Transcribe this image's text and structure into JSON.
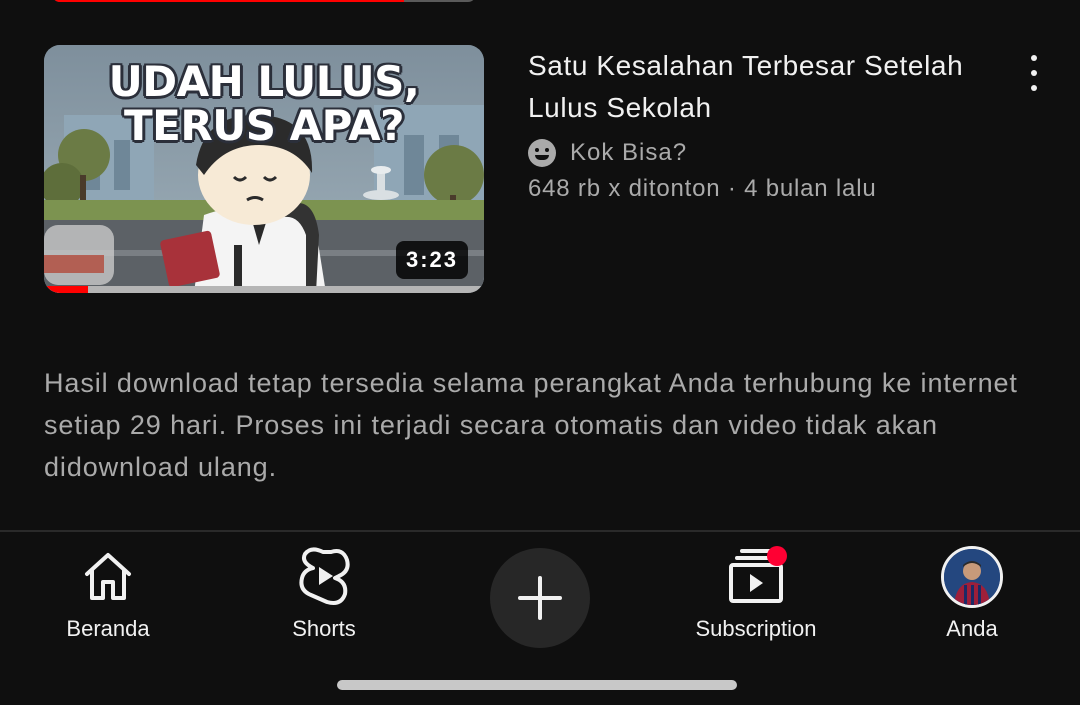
{
  "previous_item": {
    "watch_progress": 0.83
  },
  "video": {
    "thumbnail_text_line1": "UDAH LULUS,",
    "thumbnail_text_line2": "TERUS APA?",
    "duration": "3:23",
    "watch_progress": 0.1,
    "title": "Satu Kesalahan Terbesar Setelah Lulus Sekolah",
    "channel": "Kok Bisa?",
    "stats": "648 rb x ditonton · 4 bulan lalu",
    "more_icon": "more-vertical-icon"
  },
  "info_text": "Hasil download tetap tersedia selama perangkat Anda terhubung ke internet setiap 29 hari. Proses ini terjadi secara otomatis dan video tidak akan didownload ulang.",
  "bottom_nav": {
    "home_label": "Beranda",
    "shorts_label": "Shorts",
    "create_icon": "plus-icon",
    "subscriptions_label": "Subscription",
    "subscriptions_has_new": true,
    "you_label": "Anda"
  },
  "colors": {
    "background": "#0f0f0f",
    "accent_red": "#ff0000",
    "secondary_text": "#aaaaaa"
  }
}
